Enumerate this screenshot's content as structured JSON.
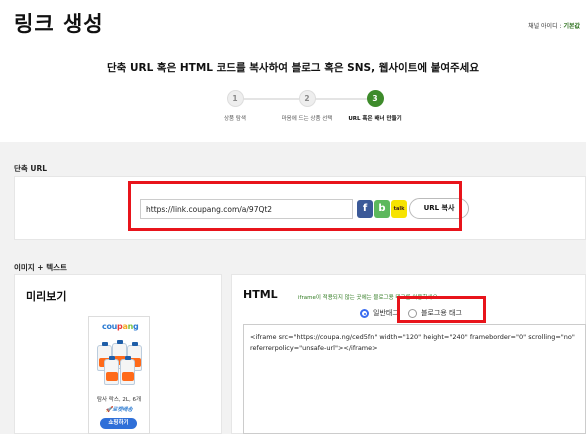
{
  "header": {
    "title": "링크 생성",
    "channel_label": "채널 아이디 :",
    "channel_value": "기본값",
    "subtitle": "단축 URL 혹은 HTML 코드를 복사하여 블로그 혹은 SNS, 웹사이트에 붙여주세요"
  },
  "steps": [
    {
      "num": "1",
      "label": "상품 탐색",
      "active": false
    },
    {
      "num": "2",
      "label": "마음에 드는 상품 선택",
      "active": false
    },
    {
      "num": "3",
      "label": "URL 혹은 배너 만들기",
      "active": true
    }
  ],
  "short_url": {
    "section_label": "단축 URL",
    "value": "https://link.coupang.com/a/97Qt2",
    "copy_label": "URL 복사",
    "share_icons": [
      {
        "name": "facebook-icon",
        "glyph": "f",
        "color": "#3b5998"
      },
      {
        "name": "blog-icon",
        "glyph": "b",
        "color": "#5cb85c"
      },
      {
        "name": "kakaotalk-icon",
        "glyph": "talk",
        "color": "#f7e300"
      }
    ]
  },
  "image_text": {
    "section_label": "이미지 + 텍스트",
    "preview_title": "미리보기",
    "banner": {
      "logo": "coupang",
      "product_name": "탐사 락스, 2L, 6개",
      "delivery": "로켓배송",
      "button": "쇼핑하기"
    },
    "html_title": "HTML",
    "note": "iframe이 적용되지 않는 곳에는 블로그용 태그를 이용하세요",
    "radio_options": [
      {
        "label": "일반태그",
        "selected": true
      },
      {
        "label": "블로그용 태그",
        "selected": false
      }
    ],
    "code": "<iframe src=\"https://coupa.ng/ced5fn\" width=\"120\" height=\"240\" frameborder=\"0\" scrolling=\"no\" referrerpolicy=\"unsafe-url\"></iframe>"
  },
  "colors": {
    "accent_green": "#3e8b2b",
    "highlight_red": "#e8141b",
    "radio_blue": "#3a6cf0",
    "coupang_blue": "#2c7bd1"
  }
}
